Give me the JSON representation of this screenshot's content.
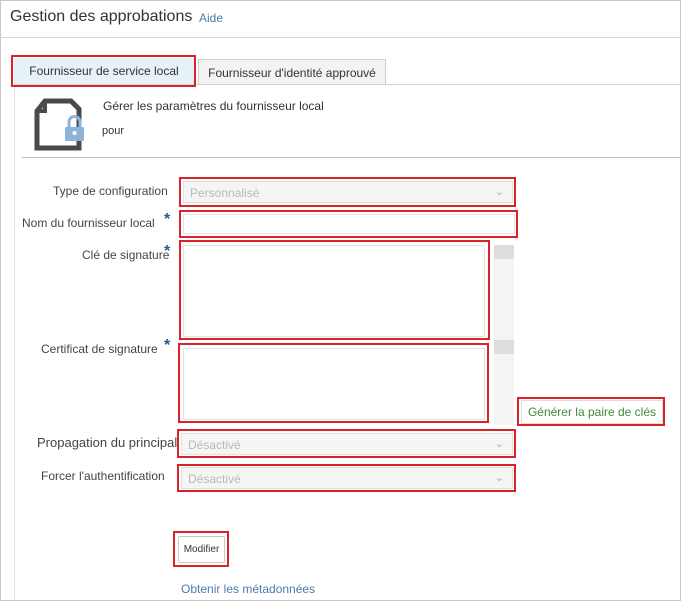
{
  "header": {
    "title": "Gestion des approbations",
    "help_link": "Aide"
  },
  "tabs": [
    {
      "label": "Fournisseur de service local",
      "active": true
    },
    {
      "label": "Fournisseur d'identité approuvé",
      "active": false
    }
  ],
  "provider": {
    "icon": "document-lock-icon",
    "title": "Gérer les paramètres du fournisseur local",
    "subtitle": "pour"
  },
  "form": {
    "config_type": {
      "label": "Type de configuration",
      "value": "Personnalisé"
    },
    "provider_name": {
      "label": "Nom du fournisseur local",
      "required_mark": "*",
      "value": ""
    },
    "signing_key": {
      "label": "Clé de signature",
      "required_mark": "*",
      "value": ""
    },
    "signing_cert": {
      "label": "Certificat de signature",
      "required_mark": "*",
      "value": ""
    },
    "principal_propagation": {
      "label": "Propagation du principal",
      "value": "Désactivé"
    },
    "force_auth": {
      "label": "Forcer l'authentification",
      "value": "Désactivé"
    }
  },
  "buttons": {
    "generate_keypair": "Générer la paire de clés",
    "modify": "Modifier"
  },
  "links": {
    "metadata": "Obtenir les métadonnées"
  },
  "colors": {
    "highlight": "#d9222a",
    "link": "#4a7ab0",
    "required": "#1f5b96",
    "generate_text": "#3d8a3d"
  }
}
